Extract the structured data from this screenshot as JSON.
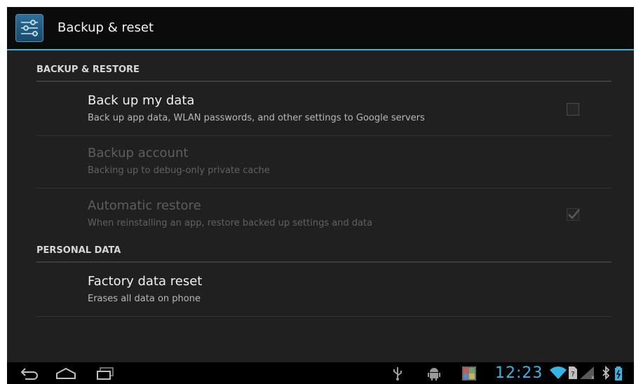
{
  "action_bar": {
    "title": "Backup & reset",
    "icon": "settings-sliders-icon"
  },
  "sections": {
    "backup_restore": {
      "header": "BACKUP & RESTORE",
      "items": [
        {
          "title": "Back up my data",
          "summary": "Back up app data, WLAN passwords, and other settings to Google servers",
          "checked": false,
          "enabled": true
        },
        {
          "title": "Backup account",
          "summary": "Backing up to debug-only private cache",
          "enabled": false
        },
        {
          "title": "Automatic restore",
          "summary": "When reinstalling an app, restore backed up settings and data",
          "checked": true,
          "enabled": false
        }
      ]
    },
    "personal_data": {
      "header": "PERSONAL DATA",
      "items": [
        {
          "title": "Factory data reset",
          "summary": "Erases all data on phone",
          "enabled": true
        }
      ]
    }
  },
  "system_bar": {
    "nav_icons": [
      "back-icon",
      "home-icon",
      "recent-apps-icon"
    ],
    "notification_icons": [
      "usb-icon",
      "android-debug-icon",
      "gallery-app-icon"
    ],
    "clock": "12:23",
    "status_icons": [
      "wifi-icon",
      "no-sim-icon",
      "signal-icon",
      "bluetooth-icon",
      "battery-charging-icon"
    ],
    "accent_color": "#33b5e5"
  }
}
